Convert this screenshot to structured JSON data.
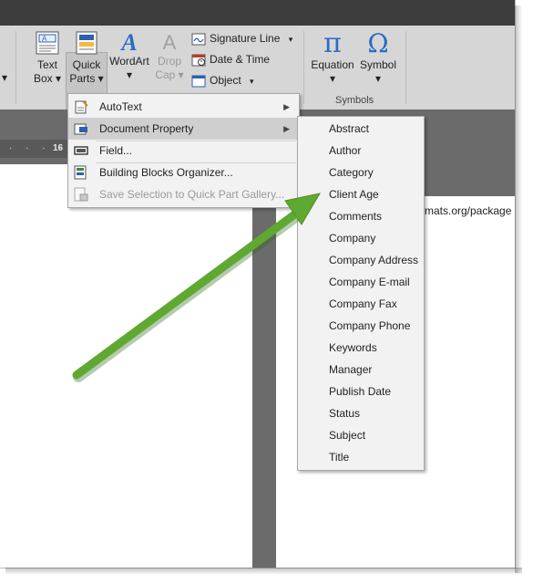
{
  "ribbon": {
    "text_box": {
      "line1": "Text",
      "line2": "Box"
    },
    "quick_parts": {
      "line1": "Quick",
      "line2": "Parts"
    },
    "wordart": {
      "label": "WordArt"
    },
    "drop_cap": {
      "line1": "Drop",
      "line2": "Cap"
    },
    "signature_line": "Signature Line",
    "date_time": "Date & Time",
    "object": "Object",
    "equation": "Equation",
    "symbol": "Symbol",
    "symbols_group": "Symbols",
    "pi_glyph": "π",
    "omega_glyph": "Ω",
    "wordart_glyph": "A",
    "dropcap_glyph": "A"
  },
  "ruler": {
    "mark": "16"
  },
  "document": {
    "url_fragment": "rmats.org/package"
  },
  "quick_parts_menu": {
    "items": [
      {
        "label": "AutoText",
        "has_submenu": true,
        "disabled": false,
        "highlighted": false,
        "icon": "autotext-icon"
      },
      {
        "label": "Document Property",
        "has_submenu": true,
        "disabled": false,
        "highlighted": true,
        "icon": "document-property-icon"
      },
      {
        "label": "Field...",
        "has_submenu": false,
        "disabled": false,
        "highlighted": false,
        "icon": "field-icon"
      },
      {
        "label": "Building Blocks Organizer...",
        "has_submenu": false,
        "disabled": false,
        "highlighted": false,
        "icon": "building-blocks-icon"
      },
      {
        "label": "Save Selection to Quick Part Gallery...",
        "has_submenu": false,
        "disabled": true,
        "highlighted": false,
        "icon": "save-selection-icon"
      }
    ]
  },
  "document_property_menu": {
    "items": [
      "Abstract",
      "Author",
      "Category",
      "Client Age",
      "Comments",
      "Company",
      "Company Address",
      "Company E-mail",
      "Company Fax",
      "Company Phone",
      "Keywords",
      "Manager",
      "Publish Date",
      "Status",
      "Subject",
      "Title"
    ]
  },
  "colors": {
    "arrow": "#5fa832",
    "ribbon": "#d6d6d6",
    "menu": "#f2f2f2",
    "highlight": "#cfcfcf"
  }
}
